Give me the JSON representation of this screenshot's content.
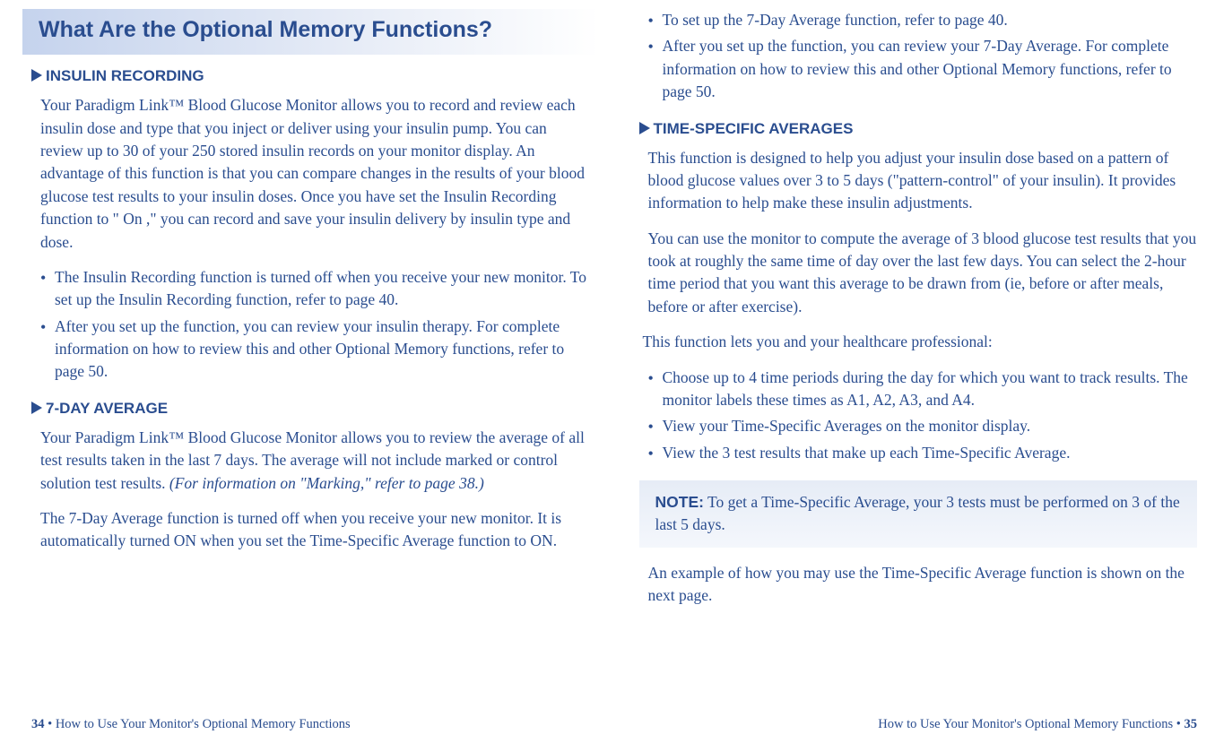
{
  "left": {
    "header_title": "What Are the Optional Memory Functions?",
    "sec1": {
      "heading": "INSULIN RECORDING",
      "para": "Your Paradigm Link™ Blood Glucose Monitor allows you to record and review each insulin dose and type that you inject or deliver using your insulin pump. You can review up to 30 of your 250 stored insulin records on your monitor display. An advantage of this function is that you can compare changes in the results of your blood glucose test results to your insulin doses. Once you have set the Insulin Recording function to \" On ,\" you can record and save your insulin delivery by insulin type and dose.",
      "b1": "The Insulin Recording function is turned off when you receive your new monitor. To set up the Insulin Recording function, refer to page 40.",
      "b2": "After you set up the function, you can review your insulin therapy. For complete information on how to review this and other Optional Memory functions, refer to page 50."
    },
    "sec2": {
      "heading": "7-DAY AVERAGE",
      "para1a": "Your Paradigm Link™ Blood Glucose Monitor allows you to review the average of all test results taken in the last 7 days. The average will not include marked or control solution test results. ",
      "para1b": "(For information on \"Marking,\" refer to page 38.)",
      "para2": "The 7-Day Average function is turned off when you receive your new monitor. It is automatically turned ON when you set the Time-Specific Average function to ON."
    },
    "footer_num": "34",
    "footer_text": " • How to Use Your Monitor's Optional Memory Functions"
  },
  "right": {
    "top": {
      "b1": "To set up the 7-Day Average function, refer to page 40.",
      "b2": "After you set up the function, you can review your 7-Day Average. For complete information on how to review this and other Optional Memory functions, refer to page 50."
    },
    "sec3": {
      "heading": "TIME-SPECIFIC AVERAGES",
      "para1": "This function is designed to help you adjust your insulin dose based on a pattern of blood glucose values over 3 to 5 days (\"pattern-control\" of your insulin). It provides information to help make these insulin adjustments.",
      "para2": "You can use the monitor to compute the average of 3 blood glucose test results that you took at roughly the same time of day over the last few days. You can select the 2-hour time period that you want this average to be drawn from (ie, before or after meals, before or after exercise).",
      "para3": "This function lets you and your healthcare professional:",
      "b1": "Choose up to 4 time periods during the day for which you want to track results. The monitor labels these times as A1, A2, A3, and A4.",
      "b2": "View your Time-Specific Averages on the monitor display.",
      "b3": "View the 3 test results that make up each Time-Specific Average."
    },
    "note_label": "NOTE:",
    "note_text": " To get a Time-Specific Average, your 3 tests must be performed on 3 of the last 5 days.",
    "closing": "An example of how you may use the Time-Specific Average function is shown on the next page.",
    "footer_text": "How to Use Your Monitor's Optional Memory Functions • ",
    "footer_num": "35"
  }
}
